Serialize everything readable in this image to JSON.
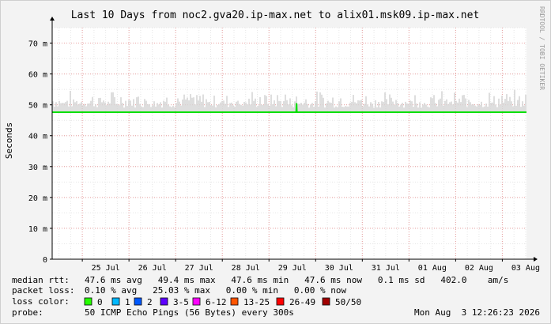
{
  "colors": {
    "background": "#f3f3f3",
    "canvas": "#ffffff",
    "frame": "#cfcfcf",
    "grid_minor": "#e6e6e6",
    "grid_major": "#e8a0a0",
    "axis": "#000000",
    "text": "#000000",
    "smoke": "#d6d6d6",
    "median": "#00e000",
    "watermark": "#999999"
  },
  "watermark": "RRDTOOL / TOBI OETIKER",
  "chart_data": {
    "type": "line",
    "title": "Last 10 Days from noc2.gva20.ip-max.net to alix01.msk09.ip-max.net",
    "ylabel": "Seconds",
    "xlabel": "",
    "ylim": [
      0,
      75
    ],
    "yunit": "ms",
    "grid": true,
    "y_ticks": [
      {
        "value": 0,
        "label": "0"
      },
      {
        "value": 10,
        "label": "10 m"
      },
      {
        "value": 20,
        "label": "20 m"
      },
      {
        "value": 30,
        "label": "30 m"
      },
      {
        "value": 40,
        "label": "40 m"
      },
      {
        "value": 50,
        "label": "50 m"
      },
      {
        "value": 60,
        "label": "60 m"
      },
      {
        "value": 70,
        "label": "70 m"
      }
    ],
    "x_domain": [
      "2026-07-24 08:30",
      "2026-08-03 12:26"
    ],
    "x_ticks": [
      {
        "date": "2026-07-25",
        "label": "25 Jul"
      },
      {
        "date": "2026-07-26",
        "label": "26 Jul"
      },
      {
        "date": "2026-07-27",
        "label": "27 Jul"
      },
      {
        "date": "2026-07-28",
        "label": "28 Jul"
      },
      {
        "date": "2026-07-29",
        "label": "29 Jul"
      },
      {
        "date": "2026-07-30",
        "label": "30 Jul"
      },
      {
        "date": "2026-07-31",
        "label": "31 Jul"
      },
      {
        "date": "2026-08-01",
        "label": "01 Aug"
      },
      {
        "date": "2026-08-02",
        "label": "02 Aug"
      },
      {
        "date": "2026-08-03",
        "label": "03 Aug"
      }
    ],
    "series": [
      {
        "kind": "median",
        "color": "#00e000",
        "points": [
          {
            "x": "2026-07-24 08:30",
            "y": 47.6
          },
          {
            "x": "2026-07-29 14:00",
            "y": 47.6
          },
          {
            "x": "2026-07-29 14:10",
            "y": 50.5
          },
          {
            "x": "2026-07-29 14:20",
            "y": 47.6
          },
          {
            "x": "2026-08-03 12:26",
            "y": 47.6
          }
        ]
      },
      {
        "kind": "smoke",
        "color": "#d6d6d6",
        "range": [
          47.6,
          55
        ]
      }
    ]
  },
  "legend": {
    "median_rtt": {
      "label": "median rtt:",
      "text": "47.6 ms avg   49.4 ms max   47.6 ms min   47.6 ms now   0.1 ms sd   402.0    am/s"
    },
    "packet_loss": {
      "label": "packet loss:",
      "text": "0.10 % avg   25.03 % max   0.00 % min   0.00 % now"
    },
    "loss_color": {
      "label": "loss color:",
      "items": [
        {
          "label": "0",
          "color": "#26ff00"
        },
        {
          "label": "1",
          "color": "#00b8ff"
        },
        {
          "label": "2",
          "color": "#0059ff"
        },
        {
          "label": "3-5",
          "color": "#5e00ff"
        },
        {
          "label": "6-12",
          "color": "#ff00ff"
        },
        {
          "label": "13-25",
          "color": "#ff5500"
        },
        {
          "label": "26-49",
          "color": "#ff0000"
        },
        {
          "label": "50/50",
          "color": "#a10000"
        }
      ]
    },
    "probe": {
      "label": "probe:",
      "text": "50 ICMP Echo Pings (56 Bytes) every 300s",
      "timestamp": "Mon Aug  3 12:26:23 2026"
    }
  }
}
